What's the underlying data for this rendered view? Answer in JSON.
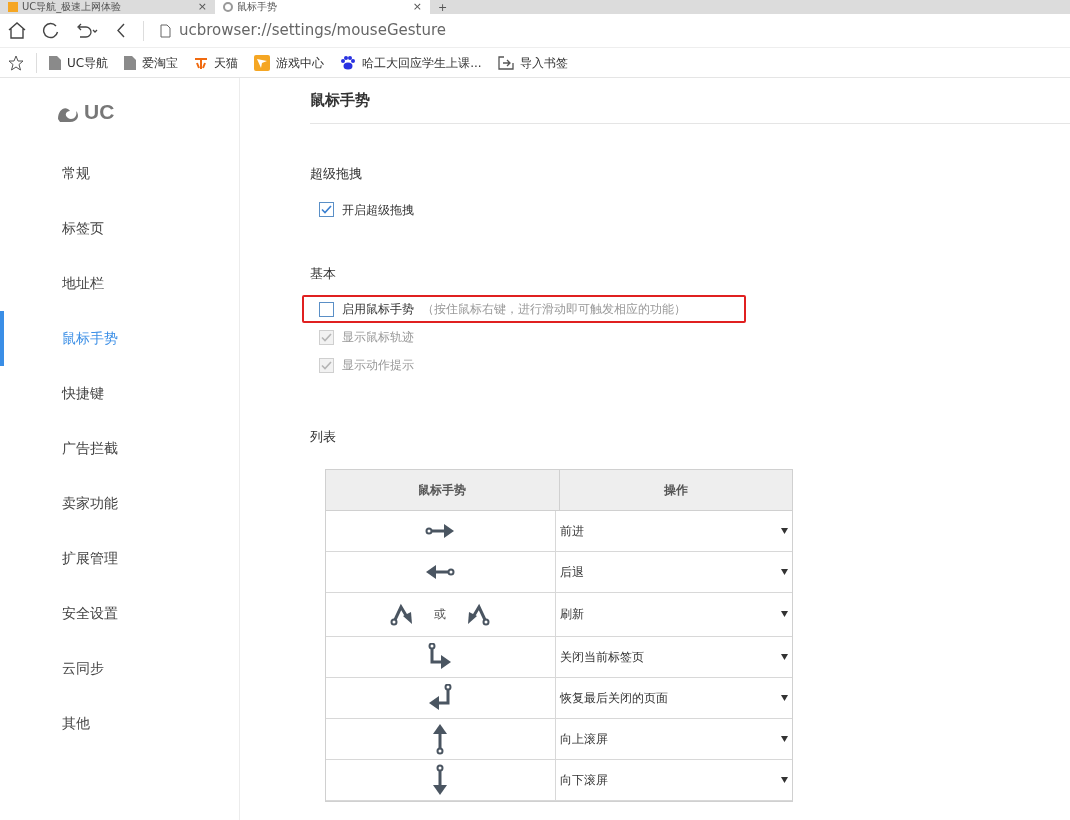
{
  "tabs": [
    {
      "title": "UC导航_极速上网体验",
      "selected": false,
      "close": "×"
    },
    {
      "title": "鼠标手势",
      "selected": true,
      "close": "×"
    }
  ],
  "new_tab": "+",
  "address": {
    "url": "ucbrowser://settings/mouseGesture"
  },
  "bookmarks": [
    {
      "label": "UC导航",
      "kind": "page"
    },
    {
      "label": "爱淘宝",
      "kind": "page"
    },
    {
      "label": "天猫",
      "kind": "tmall"
    },
    {
      "label": "游戏中心",
      "kind": "game"
    },
    {
      "label": "哈工大回应学生上课...",
      "kind": "paw"
    },
    {
      "label": "导入书签",
      "kind": "import"
    }
  ],
  "sidebar": {
    "logo": "UC",
    "items": [
      {
        "label": "常规",
        "selected": false
      },
      {
        "label": "标签页",
        "selected": false
      },
      {
        "label": "地址栏",
        "selected": false
      },
      {
        "label": "鼠标手势",
        "selected": true
      },
      {
        "label": "快捷键",
        "selected": false
      },
      {
        "label": "广告拦截",
        "selected": false
      },
      {
        "label": "卖家功能",
        "selected": false
      },
      {
        "label": "扩展管理",
        "selected": false
      },
      {
        "label": "安全设置",
        "selected": false
      },
      {
        "label": "云同步",
        "selected": false
      },
      {
        "label": "其他",
        "selected": false
      }
    ]
  },
  "page_title": "鼠标手势",
  "sections": [
    {
      "title": "超级拖拽",
      "options": [
        {
          "label": "开启超级拖拽",
          "checked": true,
          "disabled": false,
          "highlighted": false
        }
      ]
    },
    {
      "title": "基本",
      "options": [
        {
          "label": "启用鼠标手势",
          "hint": "（按住鼠标右键，进行滑动即可触发相应的功能）",
          "checked": false,
          "disabled": false,
          "highlighted": true
        },
        {
          "label": "显示鼠标轨迹",
          "checked": true,
          "disabled": true,
          "highlighted": false
        },
        {
          "label": "显示动作提示",
          "checked": true,
          "disabled": true,
          "highlighted": false
        }
      ]
    }
  ],
  "list": {
    "title": "列表",
    "columns": [
      "鼠标手势",
      "操作"
    ],
    "rows": [
      {
        "kind": "right",
        "action": "前进"
      },
      {
        "kind": "left",
        "action": "后退"
      },
      {
        "kind": "refresh",
        "or": "或",
        "action": "刷新"
      },
      {
        "kind": "down-right",
        "action": "关闭当前标签页"
      },
      {
        "kind": "down-left",
        "action": "恢复最后关闭的页面"
      },
      {
        "kind": "up",
        "action": "向上滚屏"
      },
      {
        "kind": "down",
        "action": "向下滚屏"
      }
    ]
  }
}
